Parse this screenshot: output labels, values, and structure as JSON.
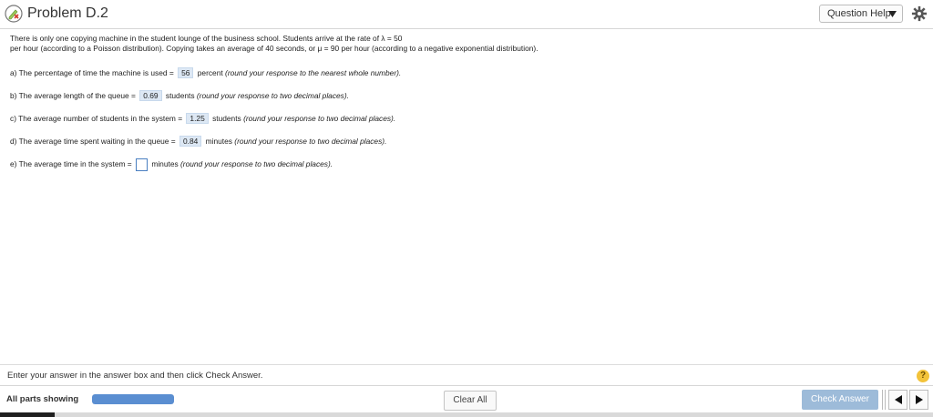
{
  "header": {
    "title": "Problem D.2",
    "question_help_label": "Question Help"
  },
  "problem": {
    "intro_line1": "There is only one copying machine in the student lounge of the business school. Students arrive at the rate of λ = 50",
    "intro_line2": "per hour (according to a Poisson distribution). Copying takes an average of 40 seconds, or μ = 90 per hour (according to a negative exponential distribution).",
    "parts": [
      {
        "prefix": "a) The percentage of time the machine is used =",
        "answer": "56",
        "unit": "percent",
        "hint": "(round your response to the nearest whole number)."
      },
      {
        "prefix": "b) The average length of the queue =",
        "answer": "0.69",
        "unit": "students",
        "hint": "(round your response to two decimal places)."
      },
      {
        "prefix": "c) The average number of students in the system =",
        "answer": "1.25",
        "unit": "students",
        "hint": "(round your response to two decimal places)."
      },
      {
        "prefix": "d) The average time spent waiting in the queue =",
        "answer": "0.84",
        "unit": "minutes",
        "hint": "(round your response to two decimal places)."
      },
      {
        "prefix": "e) The average time in the system =",
        "answer": "",
        "unit": "minutes",
        "hint": "(round your response to two decimal places)."
      }
    ]
  },
  "instructions": "Enter your answer in the answer box and then click Check Answer.",
  "footer": {
    "parts_label": "All parts showing",
    "progress": 1.0,
    "clear_label": "Clear All",
    "check_label": "Check Answer"
  },
  "colors": {
    "accent": "#5a8ed1",
    "check_button": "#9dbbd9",
    "answer_bg": "#dde8f4",
    "help_icon": "#f3c33a"
  },
  "icons": {
    "status": "pencil-x-icon",
    "settings": "gear-icon",
    "help": "question-mark-icon",
    "prev": "arrow-left-icon",
    "next": "arrow-right-icon"
  }
}
